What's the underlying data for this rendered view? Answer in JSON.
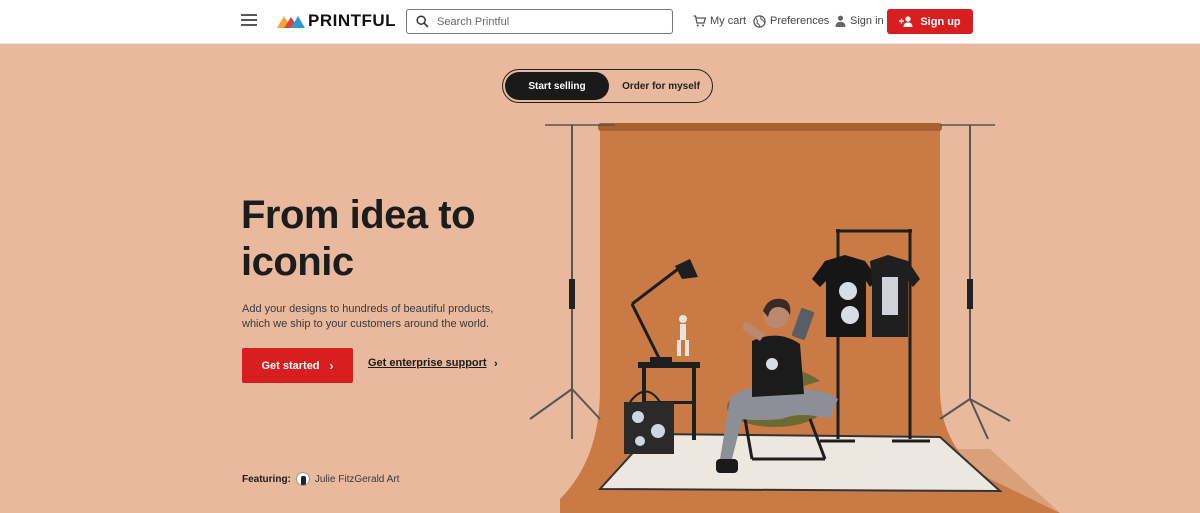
{
  "header": {
    "logo_text": "PRINTFUL",
    "search_placeholder": "Search Printful",
    "cart_label": "My cart",
    "preferences_label": "Preferences",
    "signin_label": "Sign in",
    "signup_label": "Sign up"
  },
  "hero": {
    "toggle": {
      "active": "Start selling",
      "other": "Order for myself"
    },
    "headline": "From idea to iconic",
    "subtext": "Add your designs to hundreds of beautiful products, which we ship to your customers around the world.",
    "cta_label": "Get started",
    "cta_arrow": "›",
    "enterprise_label": "Get enterprise support",
    "enterprise_arrow": "›",
    "featuring_label": "Featuring:",
    "featuring_name": "Julie FitzGerald Art"
  },
  "colors": {
    "brand_red": "#d81e1e",
    "hero_bg": "#e8b99c",
    "backdrop": "#c97a45"
  },
  "icons": [
    "hamburger-icon",
    "search-icon",
    "cart-icon",
    "globe-icon",
    "user-icon",
    "add-user-icon",
    "chevron-right-icon"
  ]
}
